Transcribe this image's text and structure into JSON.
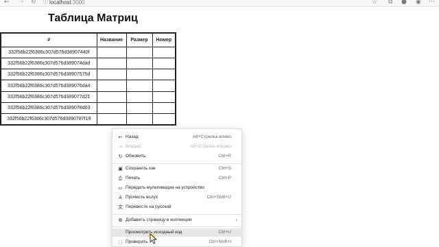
{
  "browser": {
    "url_host": "localhost",
    "url_port": ":3000",
    "icons": {
      "back": "back-arrow-icon",
      "forward": "forward-arrow-icon",
      "reload": "reload-icon",
      "info": "info-icon",
      "favorite": "star-icon",
      "collections": "collections-icon",
      "profile": "avatar"
    }
  },
  "page": {
    "title": "Таблица Матриц",
    "table": {
      "headers": [
        "#",
        "Название",
        "Размер",
        "Номер"
      ],
      "rows": [
        [
          "332f56b22f6386c307d576d38907440f",
          "",
          "",
          ""
        ],
        [
          "332f56b22f6386c307d576d389074dad",
          "",
          "",
          ""
        ],
        [
          "332f56b22f6386c307d576d38907575d",
          "",
          "",
          ""
        ],
        [
          "332f56b22f6386c307d576d389076da4",
          "",
          "",
          ""
        ],
        [
          "332f56b22f6386c307d576d389077d21",
          "",
          "",
          ""
        ],
        [
          "332f56b22f6386c307d576d389078d03",
          "",
          "",
          ""
        ],
        [
          "332f56b22f6386c307d576d3890787f19",
          "",
          "",
          ""
        ]
      ]
    }
  },
  "context_menu": {
    "items": [
      {
        "label": "Назад",
        "shortcut": "Alt+Стрелка влево",
        "icon": "arrow-left-icon",
        "disabled": false
      },
      {
        "label": "Вперед",
        "shortcut": "Alt+Стрелка вправо",
        "icon": "arrow-right-icon",
        "disabled": true
      },
      {
        "label": "Обновить",
        "shortcut": "Ctrl+R",
        "icon": "refresh-icon",
        "disabled": false
      },
      {
        "label": "Сохранить как",
        "shortcut": "Ctrl+S",
        "icon": "save-icon",
        "disabled": false
      },
      {
        "label": "Печать",
        "shortcut": "Ctrl+P",
        "icon": "print-icon",
        "disabled": false
      },
      {
        "label": "Передать мультимедиа на устройство",
        "shortcut": "",
        "icon": "cast-icon",
        "disabled": false
      },
      {
        "label": "Прочесть вслух",
        "shortcut": "Ctrl+Shift+U",
        "icon": "read-aloud-icon",
        "disabled": false
      },
      {
        "label": "Перевести на русский",
        "shortcut": "",
        "icon": "translate-icon",
        "disabled": false
      },
      {
        "label": "Добавить страницу в коллекции",
        "shortcut": "",
        "icon": "collections-icon",
        "disabled": false
      },
      {
        "label": "Просмотреть исходный код",
        "shortcut": "Ctrl+U",
        "icon": "view-source-icon",
        "disabled": false
      },
      {
        "label": "Проверить",
        "shortcut": "Ctrl+Shift+I",
        "icon": "inspect-icon",
        "disabled": false
      }
    ]
  }
}
